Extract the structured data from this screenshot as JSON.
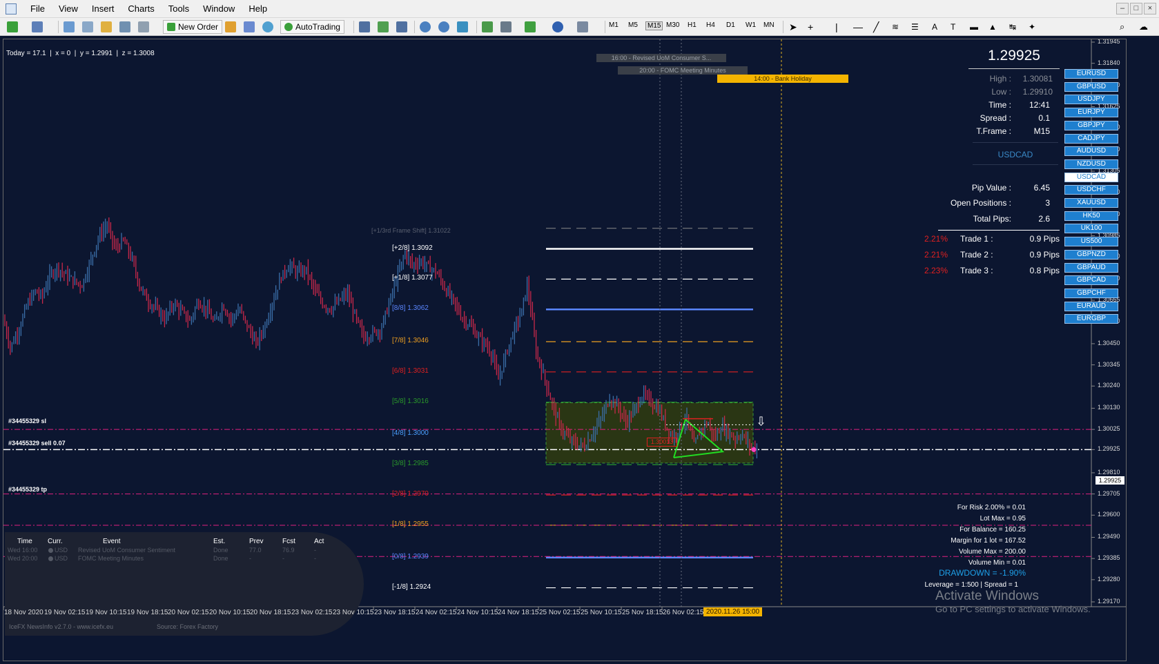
{
  "menu": [
    "File",
    "View",
    "Insert",
    "Charts",
    "Tools",
    "Window",
    "Help"
  ],
  "window_controls": [
    "–",
    "□",
    "×"
  ],
  "toolbar": {
    "new_order": "New Order",
    "autotrading": "AutoTrading",
    "timeframes": [
      "M1",
      "M5",
      "M15",
      "M30",
      "H1",
      "H4",
      "D1",
      "W1",
      "MN"
    ],
    "active_timeframe": "M15"
  },
  "crosshair": {
    "today": "Today = 17.1",
    "x": "x = 0",
    "y": "y = 1.2991",
    "z": "z = 1.3008"
  },
  "events": [
    {
      "text": "16:00 - Revised UoM Consumer S...",
      "style": "gray"
    },
    {
      "text": "20:00 - FOMC Meeting Minutes",
      "style": "gray"
    },
    {
      "text": "14:00 - Bank Holiday",
      "style": "orange"
    }
  ],
  "info": {
    "price": "1.29925",
    "high_label": "High :",
    "high": "1.30081",
    "low_label": "Low :",
    "low": "1.29910",
    "time_label": "Time :",
    "time": "12:41",
    "spread_label": "Spread :",
    "spread": "0.1",
    "tf_label": "T.Frame :",
    "tf": "M15",
    "symbol": "USDCAD",
    "pip_label": "Pip Value :",
    "pip": "6.45",
    "open_label": "Open Positions :",
    "open": "3",
    "pips_label": "Total Pips:",
    "pips": "2.6"
  },
  "trades": [
    {
      "pct": "2.21%",
      "label": "Trade 1 :",
      "pips": "0.9 Pips"
    },
    {
      "pct": "2.21%",
      "label": "Trade 2 :",
      "pips": "0.9 Pips"
    },
    {
      "pct": "2.23%",
      "label": "Trade 3 :",
      "pips": "0.8 Pips"
    }
  ],
  "symbols": [
    "EURUSD",
    "GBPUSD",
    "USDJPY",
    "EURJPY",
    "GBPJPY",
    "CADJPY",
    "AUDUSD",
    "NZDUSD",
    "USDCAD",
    "USDCHF",
    "XAUUSD",
    "HK50",
    "UK100",
    "US500",
    "GBPNZD",
    "GBPAUD",
    "GBPCAD",
    "GBPCHF",
    "EURAUD",
    "EURGBP"
  ],
  "active_symbol": "USDCAD",
  "murrey": {
    "shift_label": "[+1/3rd Frame Shift]  1.31022",
    "levels": [
      {
        "label": "[+2/8]",
        "price": "1.3092",
        "color": "#ffffff"
      },
      {
        "label": "[+1/8]",
        "price": "1.3077",
        "color": "#ffffff"
      },
      {
        "label": "[8/8]",
        "price": "1.3062",
        "color": "#5a86ff"
      },
      {
        "label": "[7/8]",
        "price": "1.3046",
        "color": "#f0a020"
      },
      {
        "label": "[6/8]",
        "price": "1.3031",
        "color": "#e02020"
      },
      {
        "label": "[5/8]",
        "price": "1.3016",
        "color": "#2a9a2a"
      },
      {
        "label": "[4/8]",
        "price": "1.3000",
        "color": "#4aa0ff"
      },
      {
        "label": "[3/8]",
        "price": "1.2985",
        "color": "#2a9a2a"
      },
      {
        "label": "[2/8]",
        "price": "1.2970",
        "color": "#e02020"
      },
      {
        "label": "[1/8]",
        "price": "1.2955",
        "color": "#f0a020"
      },
      {
        "label": "[0/8]",
        "price": "1.2939",
        "color": "#5a86ff"
      },
      {
        "label": "[-1/8]",
        "price": "1.2924",
        "color": "#ffffff"
      }
    ]
  },
  "order_labels": {
    "sl": "#34455329 sl",
    "sell": "#34455329 sell 0.07",
    "tp": "#34455329 tp",
    "entry_box": "1.30013"
  },
  "price_scale": [
    "1.31945",
    "1.31840",
    "1.31730",
    "1.31625",
    "1.31520",
    "1.31410",
    "1.31305",
    "1.31200",
    "1.31090",
    "1.30985",
    "1.30880",
    "1.30770",
    "1.30665",
    "1.30560",
    "1.30450",
    "1.30345",
    "1.30240",
    "1.30130",
    "1.30025",
    "1.29925",
    "1.29810",
    "1.29705",
    "1.29600",
    "1.29490",
    "1.29385",
    "1.29280",
    "1.29170"
  ],
  "current_price": "1.29925",
  "time_axis": [
    "18 Nov 2020",
    "19 Nov 02:15",
    "19 Nov 10:15",
    "19 Nov 18:15",
    "20 Nov 02:15",
    "20 Nov 10:15",
    "20 Nov 18:15",
    "23 Nov 02:15",
    "23 Nov 10:15",
    "23 Nov 18:15",
    "24 Nov 02:15",
    "24 Nov 10:15",
    "24 Nov 18:15",
    "25 Nov 02:15",
    "25 Nov 10:15",
    "25 Nov 18:15",
    "26 Nov 02:15"
  ],
  "time_axis_highlight": "2020.11.26 15:00",
  "news": {
    "headers": [
      "Time",
      "Curr.",
      "Event",
      "Est.",
      "Prev",
      "Fcst",
      "Act"
    ],
    "rows": [
      {
        "time": "Wed 16:00",
        "curr": "USD",
        "event": "Revised UoM Consumer Sentiment",
        "est": "Done",
        "prev": "77.0",
        "fcst": "76.9",
        "act": "-"
      },
      {
        "time": "Wed 20:00",
        "curr": "USD",
        "event": "FOMC Meeting Minutes",
        "est": "Done",
        "prev": "-",
        "fcst": "-",
        "act": "-"
      }
    ],
    "footer_left": "IceFX NewsInfo v2.7.0 - www.icefx.eu",
    "footer_right": "Source: Forex Factory"
  },
  "risk": {
    "for_risk": "For Risk 2.00% = 0.01",
    "lot_max": "Lot Max = 0.95",
    "balance": "For Balance = 160.25",
    "margin": "Margin for 1 lot = 167.52",
    "vol_max": "Volume Max = 200.00",
    "vol_min": "Volume Min = 0.01",
    "drawdown": "DRAWDOWN = -1.90%",
    "leverage": "Leverage = 1:500 | Spread = 1"
  },
  "watermark": {
    "title": "Activate Windows",
    "subtitle": "Go to PC settings to activate Windows."
  },
  "colors": {
    "bg": "#0c1630",
    "bull": "#3a6ea8",
    "bear": "#c8284a",
    "accent": "#1e7fcf",
    "drawdown": "#1ea0e8"
  }
}
